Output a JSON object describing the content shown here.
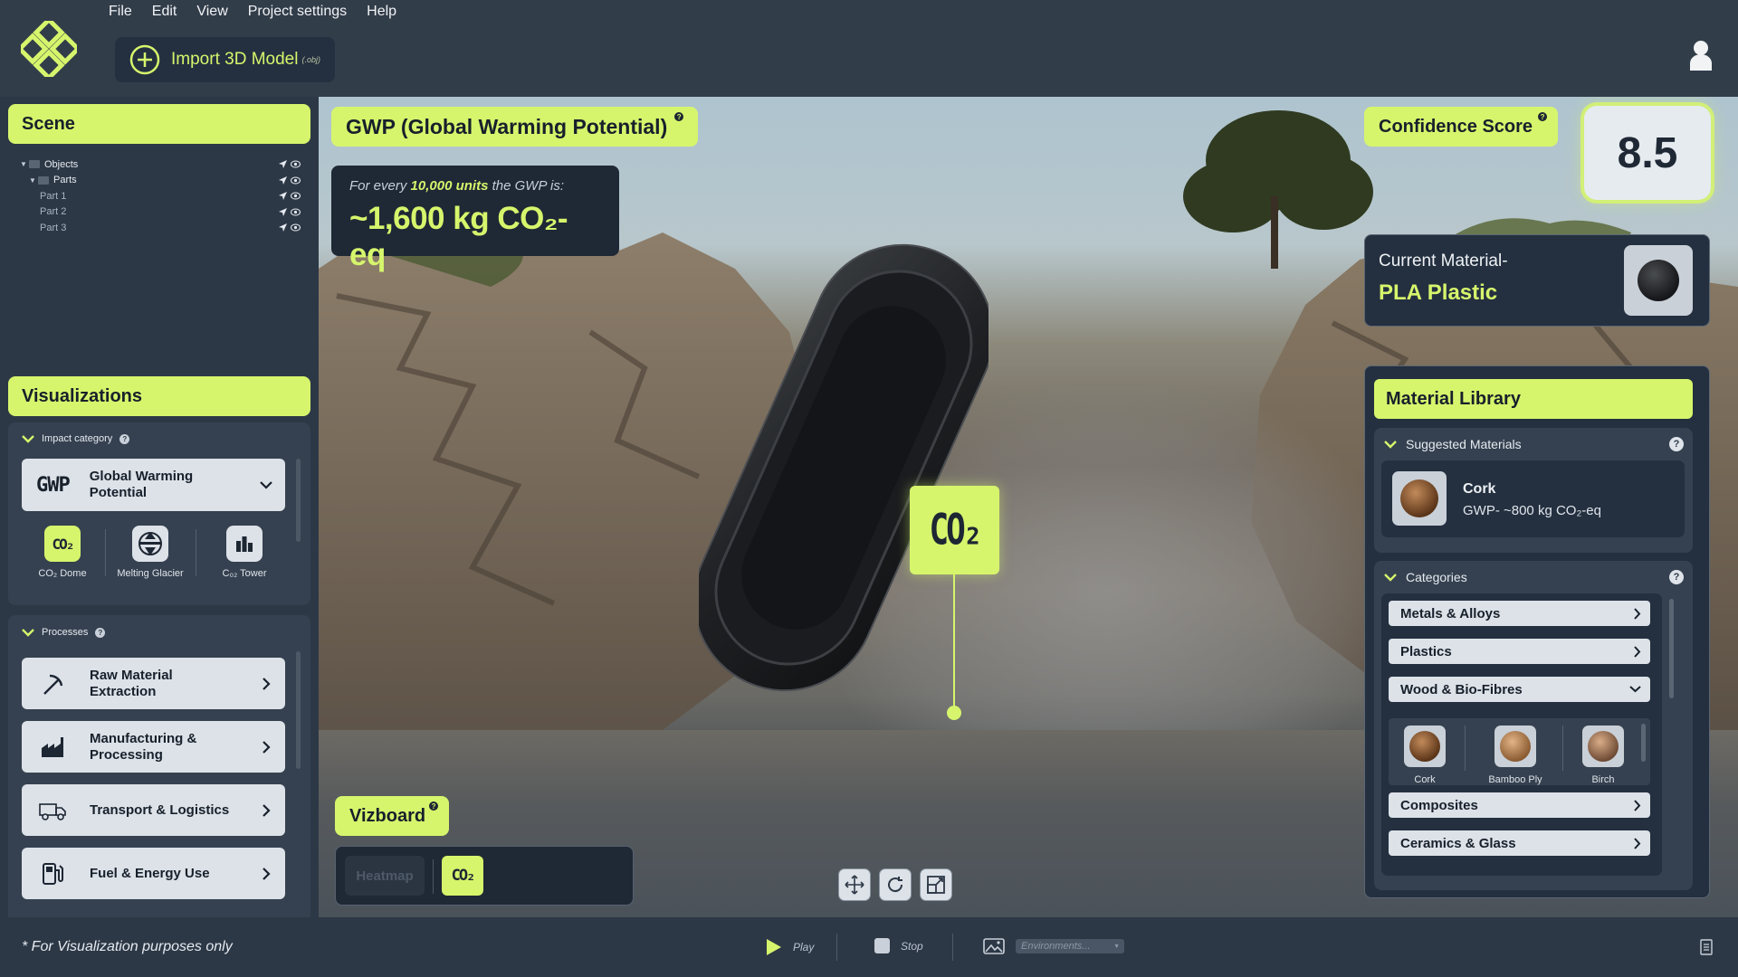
{
  "menu": [
    "File",
    "Edit",
    "View",
    "Project settings",
    "Help"
  ],
  "import_button": {
    "label": "Import 3D Model",
    "ext": "(.obj)"
  },
  "scene": {
    "title": "Scene",
    "tree": [
      {
        "label": "Objects",
        "level": 0
      },
      {
        "label": "Parts",
        "level": 1
      },
      {
        "label": "Part 1",
        "level": 2
      },
      {
        "label": "Part 2",
        "level": 2
      },
      {
        "label": "Part 3",
        "level": 2
      }
    ]
  },
  "visualizations": {
    "title": "Visualizations",
    "impact_category_label": "Impact category",
    "impact_selected": {
      "abbr": "GWP",
      "name": "Global Warming Potential"
    },
    "options": [
      {
        "icon": "co2-icon",
        "label": "CO₂ Dome",
        "active": true
      },
      {
        "icon": "glacier-icon",
        "label": "Melting Glacier",
        "active": false
      },
      {
        "icon": "tower-icon",
        "label": "C₀₂ Tower",
        "active": false
      }
    ]
  },
  "processes": {
    "title": "Processes",
    "items": [
      {
        "icon": "pickaxe-icon",
        "label": "Raw Material Extraction"
      },
      {
        "icon": "factory-icon",
        "label": "Manufacturing & Processing"
      },
      {
        "icon": "truck-icon",
        "label": "Transport & Logistics"
      },
      {
        "icon": "fuel-pump-icon",
        "label": "Fuel & Energy Use"
      }
    ]
  },
  "gwp": {
    "title": "GWP (Global Warming Potential)",
    "line_prefix": "For every",
    "units": "10,000 units",
    "line_suffix": "the GWP is:",
    "value": "~1,600 kg CO₂-eq"
  },
  "co2_marker": "CO₂",
  "vizboard": {
    "title": "Vizboard",
    "heatmap": "Heatmap",
    "co2": "CO₂"
  },
  "confidence": {
    "title": "Confidence Score",
    "value": "8.5"
  },
  "current_material": {
    "label": "Current Material-",
    "value": "PLA Plastic"
  },
  "library": {
    "title": "Material Library",
    "suggested_label": "Suggested Materials",
    "suggested": {
      "name": "Cork",
      "gwp": "GWP- ~800 kg CO₂-eq"
    },
    "categories_label": "Categories",
    "categories": [
      "Metals & Alloys",
      "Plastics",
      "Wood & Bio-Fibres",
      "Composites",
      "Ceramics & Glass"
    ],
    "expanded_materials": [
      "Cork",
      "Bamboo Ply",
      "Birch"
    ]
  },
  "bottom": {
    "disclaimer": "* For Visualization purposes only",
    "play": "Play",
    "stop": "Stop",
    "environments": "Environments..."
  },
  "colors": {
    "accent": "#d6f56c",
    "panel": "#2d3846",
    "dark": "#1f2835"
  }
}
